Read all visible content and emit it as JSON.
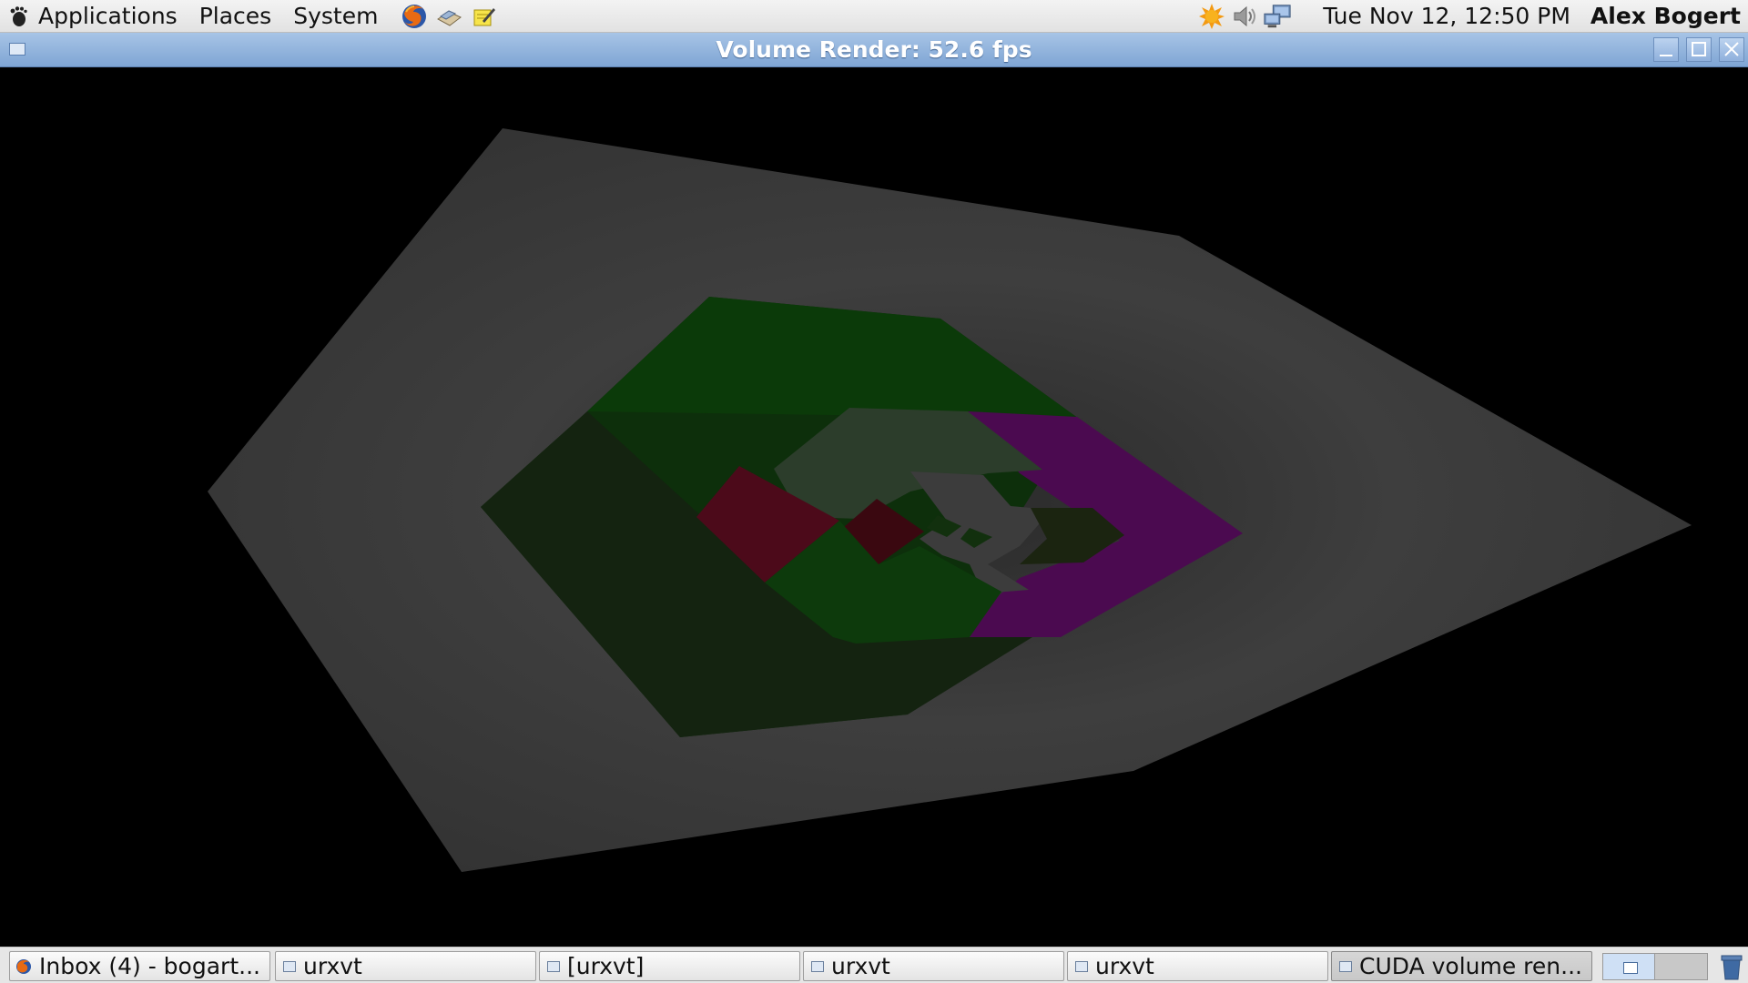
{
  "top_panel": {
    "menus": [
      "Applications",
      "Places",
      "System"
    ],
    "launchers": [
      "firefox-icon",
      "file-manager-icon",
      "text-editor-icon"
    ],
    "tray": [
      "weather-sun-icon",
      "volume-icon",
      "network-icon"
    ],
    "clock": "Tue Nov 12, 12:50 PM",
    "user": "Alex Bogert"
  },
  "window": {
    "title": "Volume Render: 52.6 fps",
    "buttons": [
      "minimize",
      "maximize",
      "close"
    ]
  },
  "taskbar": {
    "tasks": [
      {
        "label": "Inbox (4) - bogart...",
        "icon": "firefox-icon",
        "active": false
      },
      {
        "label": "urxvt",
        "icon": "window-icon",
        "active": false
      },
      {
        "label": "[urxvt]",
        "icon": "window-icon",
        "active": false
      },
      {
        "label": "urxvt",
        "icon": "window-icon",
        "active": false
      },
      {
        "label": "urxvt",
        "icon": "window-icon",
        "active": false
      },
      {
        "label": "CUDA volume ren...",
        "icon": "window-icon",
        "active": true
      }
    ],
    "workspaces": 2,
    "active_workspace": 1
  },
  "colors": {
    "panel_bg": "#e6e6e6",
    "titlebar": "#8fb0dc",
    "render_bg": "#000000",
    "volume_outer": "#3d3d3d",
    "volume_green": "#0f3a0d",
    "volume_magenta": "#5a0a5e",
    "volume_red": "#4a0715"
  }
}
